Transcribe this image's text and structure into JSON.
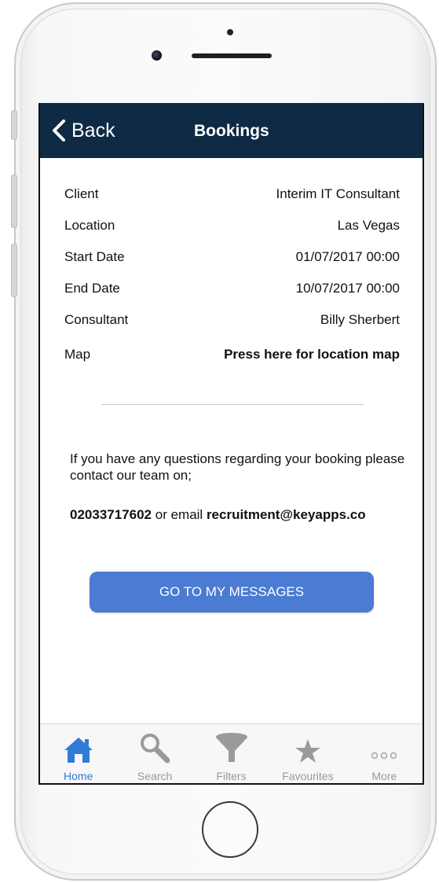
{
  "navbar": {
    "back_label": "Back",
    "title": "Bookings"
  },
  "details": [
    {
      "label": "Client",
      "value": "Interim IT Consultant"
    },
    {
      "label": "Location",
      "value": "Las Vegas"
    },
    {
      "label": "Start Date",
      "value": "01/07/2017 00:00"
    },
    {
      "label": "End Date",
      "value": "10/07/2017 00:00"
    },
    {
      "label": "Consultant",
      "value": "Billy Sherbert"
    }
  ],
  "map": {
    "label": "Map",
    "link": "Press here for location map"
  },
  "contact": {
    "message": "If you have any questions regarding your booking please contact our team on;",
    "phone": "02033717602",
    "or_email": " or email ",
    "email": "recruitment@keyapps.co"
  },
  "cta_label": "GO TO MY MESSAGES",
  "tabs": [
    {
      "label": "Home",
      "icon": "home-icon",
      "active": true
    },
    {
      "label": "Search",
      "icon": "search-icon"
    },
    {
      "label": "Filters",
      "icon": "filter-funnel-icon"
    },
    {
      "label": "Favourites",
      "icon": "star-icon"
    },
    {
      "label": "More",
      "icon": "more-dots-icon"
    }
  ],
  "colors": {
    "navbar": "#0f2a45",
    "accent": "#4b7bd2",
    "active_tab": "#2f7bd8",
    "inactive_tab": "#999999"
  }
}
